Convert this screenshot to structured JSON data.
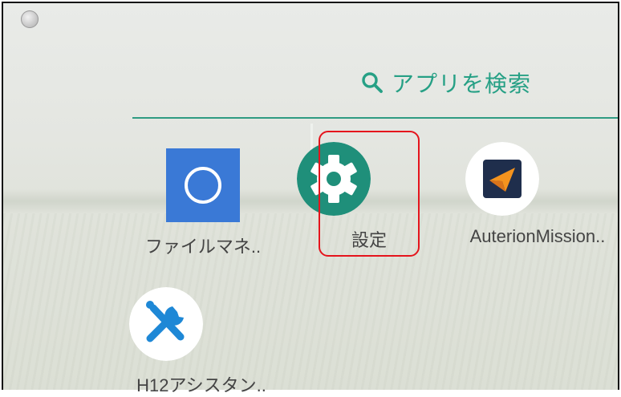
{
  "search": {
    "label": "アプリを検索",
    "icon": "search-icon"
  },
  "apps": [
    {
      "label": "ファイルマネ..",
      "icon": "folder-circle-icon"
    },
    {
      "label": "設定",
      "icon": "gear-icon"
    },
    {
      "label": "AuterionMission..",
      "icon": "auterion-logo-icon"
    },
    {
      "label": "H12アシスタン..",
      "icon": "tools-icon"
    }
  ],
  "colors": {
    "accent": "#26a085",
    "settings_bg": "#1f8f7a",
    "files_bg": "#3a79d6",
    "tools_blue": "#1e88d6",
    "highlight": "#e5141c"
  }
}
